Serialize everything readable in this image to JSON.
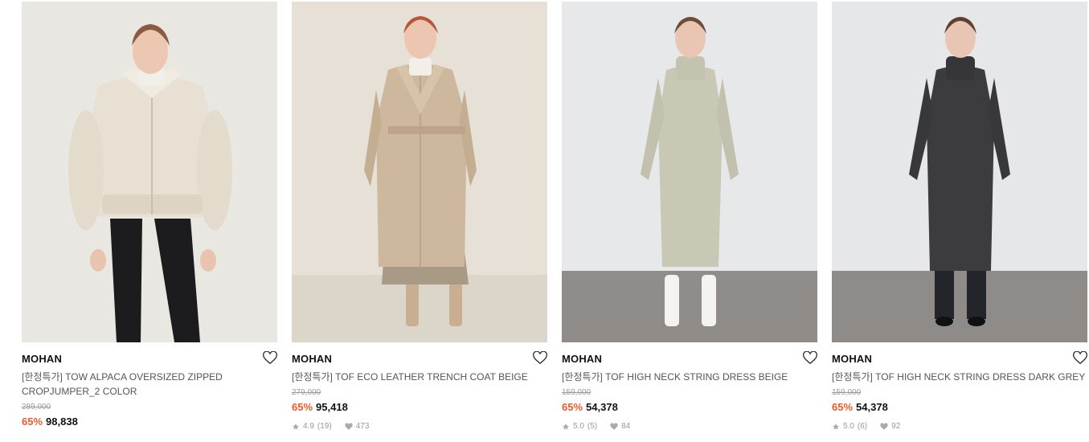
{
  "products": [
    {
      "brand": "MOHAN",
      "title": "[한정특가] TOW ALPACA OVERSIZED ZIPPED CROPJUMPER_2 COLOR",
      "original_price": "289,000",
      "discount": "65%",
      "price": "98,838",
      "rating": "",
      "reviews": "",
      "likes": "",
      "image": "model-cream-alpaca-jumper"
    },
    {
      "brand": "MOHAN",
      "title": "[한정특가] TOF ECO LEATHER TRENCH COAT BEIGE",
      "original_price": "279,000",
      "discount": "65%",
      "price": "95,418",
      "rating": "4.9",
      "reviews": "(19)",
      "likes": "473",
      "image": "model-beige-trench-coat"
    },
    {
      "brand": "MOHAN",
      "title": "[한정특가] TOF HIGH NECK STRING DRESS BEIGE",
      "original_price": "159,000",
      "discount": "65%",
      "price": "54,378",
      "rating": "5.0",
      "reviews": "(5)",
      "likes": "84",
      "image": "model-beige-high-neck-dress"
    },
    {
      "brand": "MOHAN",
      "title": "[한정특가] TOF HIGH NECK STRING DRESS DARK GREY",
      "original_price": "159,000",
      "discount": "65%",
      "price": "54,378",
      "rating": "5.0",
      "reviews": "(6)",
      "likes": "92",
      "image": "model-dark-grey-high-neck-dress"
    }
  ],
  "colors": {
    "discount": "#f05a28",
    "price": "#111111",
    "original_price": "#9a9a9a"
  },
  "icons": {
    "wishlist": "heart-outline-icon",
    "rating": "star-icon",
    "likes": "heart-filled-icon"
  }
}
